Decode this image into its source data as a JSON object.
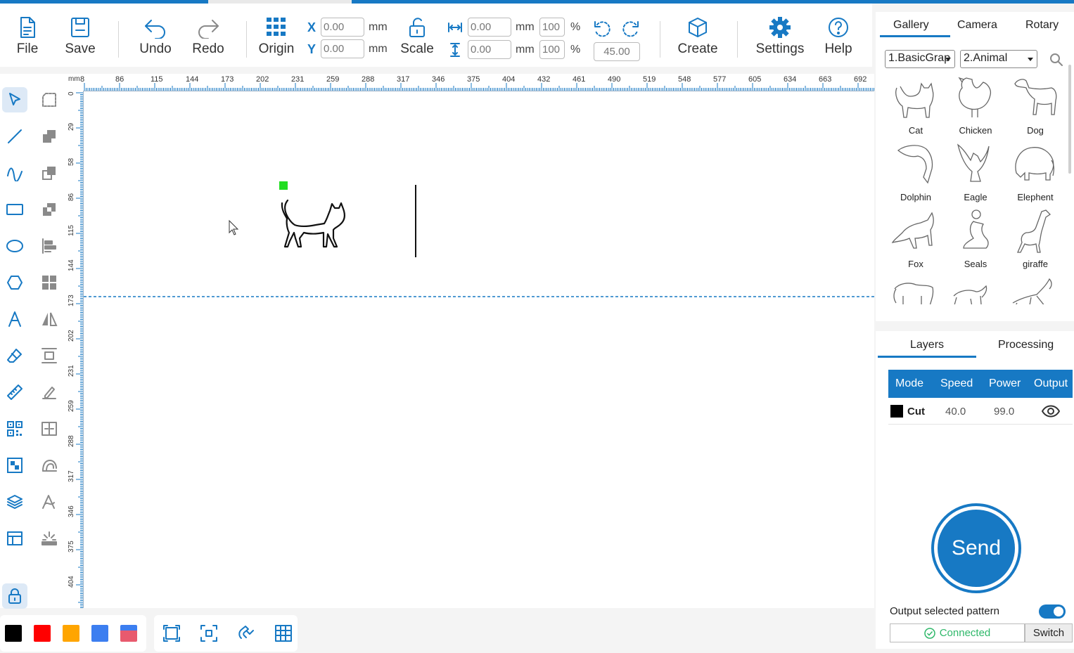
{
  "toolbar": {
    "file": "File",
    "save": "Save",
    "undo": "Undo",
    "redo": "Redo",
    "origin": "Origin",
    "scale": "Scale",
    "create": "Create",
    "settings": "Settings",
    "help": "Help",
    "x_label": "X",
    "y_label": "Y",
    "x_value": "0.00",
    "y_value": "0.00",
    "width_value": "0.00",
    "height_value": "0.00",
    "width_pct": "100",
    "height_pct": "100",
    "unit_mm": "mm",
    "unit_pct": "%",
    "rotation": "45.00"
  },
  "ruler": {
    "unit": "mm",
    "top_ticks": [
      "8",
      "86",
      "115",
      "144",
      "173",
      "202",
      "231",
      "259",
      "288",
      "317",
      "346",
      "375",
      "404",
      "432",
      "461",
      "490",
      "519",
      "548",
      "577",
      "605",
      "634",
      "663",
      "692"
    ],
    "left_ticks": [
      "0",
      "29",
      "58",
      "86",
      "115",
      "144",
      "173",
      "202",
      "231",
      "259",
      "288",
      "317",
      "346",
      "375",
      "404"
    ]
  },
  "right_tabs": {
    "gallery": "Gallery",
    "camera": "Camera",
    "rotary": "Rotary"
  },
  "gallery": {
    "category": "1.BasicGrap",
    "subcategory": "2.Animal",
    "items": [
      "Cat",
      "Chicken",
      "Dog",
      "Dolphin",
      "Eagle",
      "Elephent",
      "Fox",
      "Seals",
      "giraffe"
    ]
  },
  "layers_tabs": {
    "layers": "Layers",
    "processing": "Processing"
  },
  "layers_table": {
    "headers": [
      "Mode",
      "Speed",
      "Power",
      "Output"
    ],
    "rows": [
      {
        "mode": "Cut",
        "speed": "40.0",
        "power": "99.0",
        "color": "#000000"
      }
    ]
  },
  "send": "Send",
  "output_selected": "Output selected pattern",
  "connection": "Connected",
  "switch": "Switch",
  "colors": {
    "accent": "#1779c4",
    "swatches": [
      "#000000",
      "#ff0000",
      "#ffa500",
      "#3c7ef0",
      "#e85a6e"
    ]
  }
}
